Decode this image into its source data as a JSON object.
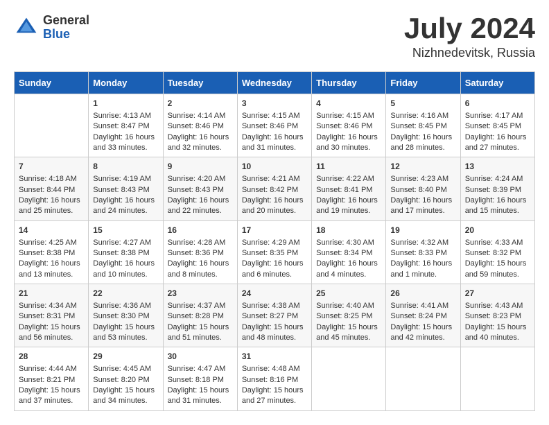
{
  "header": {
    "logo_general": "General",
    "logo_blue": "Blue",
    "month": "July 2024",
    "location": "Nizhnedevitsk, Russia"
  },
  "days_of_week": [
    "Sunday",
    "Monday",
    "Tuesday",
    "Wednesday",
    "Thursday",
    "Friday",
    "Saturday"
  ],
  "weeks": [
    [
      {
        "day": "",
        "content": ""
      },
      {
        "day": "1",
        "content": "Sunrise: 4:13 AM\nSunset: 8:47 PM\nDaylight: 16 hours\nand 33 minutes."
      },
      {
        "day": "2",
        "content": "Sunrise: 4:14 AM\nSunset: 8:46 PM\nDaylight: 16 hours\nand 32 minutes."
      },
      {
        "day": "3",
        "content": "Sunrise: 4:15 AM\nSunset: 8:46 PM\nDaylight: 16 hours\nand 31 minutes."
      },
      {
        "day": "4",
        "content": "Sunrise: 4:15 AM\nSunset: 8:46 PM\nDaylight: 16 hours\nand 30 minutes."
      },
      {
        "day": "5",
        "content": "Sunrise: 4:16 AM\nSunset: 8:45 PM\nDaylight: 16 hours\nand 28 minutes."
      },
      {
        "day": "6",
        "content": "Sunrise: 4:17 AM\nSunset: 8:45 PM\nDaylight: 16 hours\nand 27 minutes."
      }
    ],
    [
      {
        "day": "7",
        "content": "Sunrise: 4:18 AM\nSunset: 8:44 PM\nDaylight: 16 hours\nand 25 minutes."
      },
      {
        "day": "8",
        "content": "Sunrise: 4:19 AM\nSunset: 8:43 PM\nDaylight: 16 hours\nand 24 minutes."
      },
      {
        "day": "9",
        "content": "Sunrise: 4:20 AM\nSunset: 8:43 PM\nDaylight: 16 hours\nand 22 minutes."
      },
      {
        "day": "10",
        "content": "Sunrise: 4:21 AM\nSunset: 8:42 PM\nDaylight: 16 hours\nand 20 minutes."
      },
      {
        "day": "11",
        "content": "Sunrise: 4:22 AM\nSunset: 8:41 PM\nDaylight: 16 hours\nand 19 minutes."
      },
      {
        "day": "12",
        "content": "Sunrise: 4:23 AM\nSunset: 8:40 PM\nDaylight: 16 hours\nand 17 minutes."
      },
      {
        "day": "13",
        "content": "Sunrise: 4:24 AM\nSunset: 8:39 PM\nDaylight: 16 hours\nand 15 minutes."
      }
    ],
    [
      {
        "day": "14",
        "content": "Sunrise: 4:25 AM\nSunset: 8:38 PM\nDaylight: 16 hours\nand 13 minutes."
      },
      {
        "day": "15",
        "content": "Sunrise: 4:27 AM\nSunset: 8:38 PM\nDaylight: 16 hours\nand 10 minutes."
      },
      {
        "day": "16",
        "content": "Sunrise: 4:28 AM\nSunset: 8:36 PM\nDaylight: 16 hours\nand 8 minutes."
      },
      {
        "day": "17",
        "content": "Sunrise: 4:29 AM\nSunset: 8:35 PM\nDaylight: 16 hours\nand 6 minutes."
      },
      {
        "day": "18",
        "content": "Sunrise: 4:30 AM\nSunset: 8:34 PM\nDaylight: 16 hours\nand 4 minutes."
      },
      {
        "day": "19",
        "content": "Sunrise: 4:32 AM\nSunset: 8:33 PM\nDaylight: 16 hours\nand 1 minute."
      },
      {
        "day": "20",
        "content": "Sunrise: 4:33 AM\nSunset: 8:32 PM\nDaylight: 15 hours\nand 59 minutes."
      }
    ],
    [
      {
        "day": "21",
        "content": "Sunrise: 4:34 AM\nSunset: 8:31 PM\nDaylight: 15 hours\nand 56 minutes."
      },
      {
        "day": "22",
        "content": "Sunrise: 4:36 AM\nSunset: 8:30 PM\nDaylight: 15 hours\nand 53 minutes."
      },
      {
        "day": "23",
        "content": "Sunrise: 4:37 AM\nSunset: 8:28 PM\nDaylight: 15 hours\nand 51 minutes."
      },
      {
        "day": "24",
        "content": "Sunrise: 4:38 AM\nSunset: 8:27 PM\nDaylight: 15 hours\nand 48 minutes."
      },
      {
        "day": "25",
        "content": "Sunrise: 4:40 AM\nSunset: 8:25 PM\nDaylight: 15 hours\nand 45 minutes."
      },
      {
        "day": "26",
        "content": "Sunrise: 4:41 AM\nSunset: 8:24 PM\nDaylight: 15 hours\nand 42 minutes."
      },
      {
        "day": "27",
        "content": "Sunrise: 4:43 AM\nSunset: 8:23 PM\nDaylight: 15 hours\nand 40 minutes."
      }
    ],
    [
      {
        "day": "28",
        "content": "Sunrise: 4:44 AM\nSunset: 8:21 PM\nDaylight: 15 hours\nand 37 minutes."
      },
      {
        "day": "29",
        "content": "Sunrise: 4:45 AM\nSunset: 8:20 PM\nDaylight: 15 hours\nand 34 minutes."
      },
      {
        "day": "30",
        "content": "Sunrise: 4:47 AM\nSunset: 8:18 PM\nDaylight: 15 hours\nand 31 minutes."
      },
      {
        "day": "31",
        "content": "Sunrise: 4:48 AM\nSunset: 8:16 PM\nDaylight: 15 hours\nand 27 minutes."
      },
      {
        "day": "",
        "content": ""
      },
      {
        "day": "",
        "content": ""
      },
      {
        "day": "",
        "content": ""
      }
    ]
  ]
}
